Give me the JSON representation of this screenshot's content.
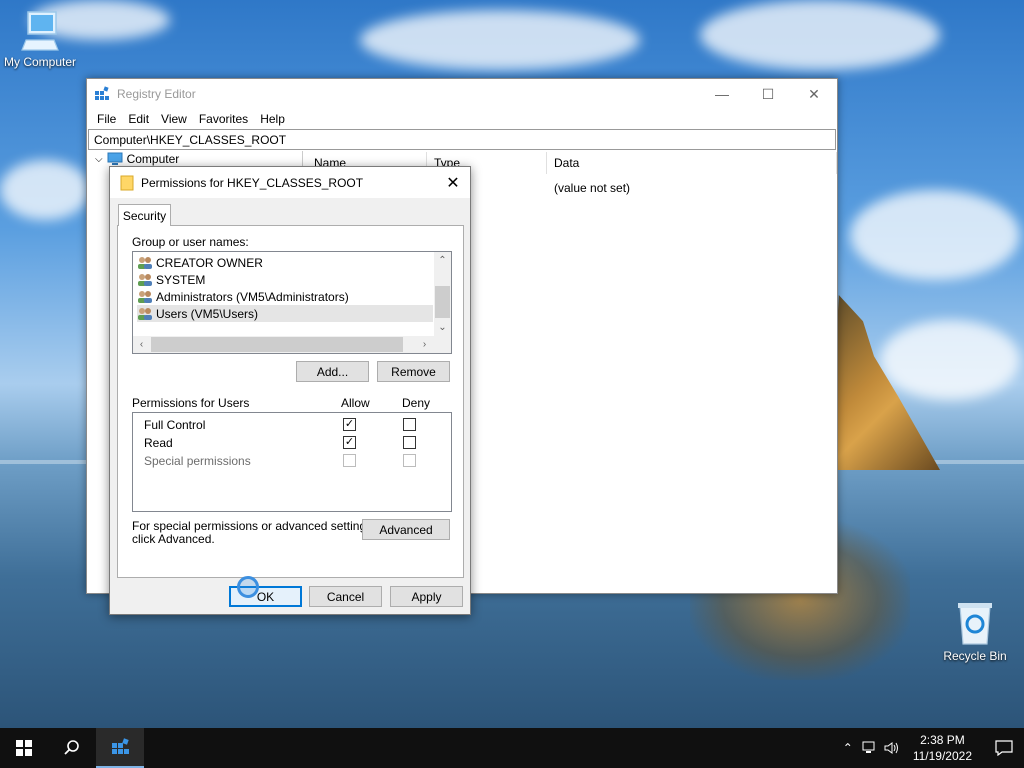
{
  "desktop": {
    "icons": [
      {
        "label": "My Computer"
      },
      {
        "label": "Recycle Bin"
      }
    ]
  },
  "regedit": {
    "title": "Registry Editor",
    "menu": [
      "File",
      "Edit",
      "View",
      "Favorites",
      "Help"
    ],
    "address": "Computer\\HKEY_CLASSES_ROOT",
    "tree_root": "Computer",
    "columns": {
      "name": "Name",
      "type": "Type",
      "data": "Data"
    },
    "row": {
      "data": "(value not set)"
    }
  },
  "dialog": {
    "title": "Permissions for HKEY_CLASSES_ROOT",
    "tab": "Security",
    "group_label": "Group or user names:",
    "users": [
      {
        "name": "CREATOR OWNER"
      },
      {
        "name": "SYSTEM"
      },
      {
        "name": "Administrators (VM5\\Administrators)"
      },
      {
        "name": "Users (VM5\\Users)"
      }
    ],
    "add_label": "Add...",
    "remove_label": "Remove",
    "perm_label": "Permissions for Users",
    "allow_label": "Allow",
    "deny_label": "Deny",
    "permissions": [
      {
        "name": "Full Control",
        "allow": true,
        "deny": false,
        "enabled": true
      },
      {
        "name": "Read",
        "allow": true,
        "deny": false,
        "enabled": true
      },
      {
        "name": "Special permissions",
        "allow": false,
        "deny": false,
        "enabled": false
      }
    ],
    "special_note_1": "For special permissions or advanced settings,",
    "special_note_2": "click Advanced.",
    "advanced_label": "Advanced",
    "ok_label": "OK",
    "cancel_label": "Cancel",
    "apply_label": "Apply"
  },
  "taskbar": {
    "time": "2:38 PM",
    "date": "11/19/2022"
  },
  "colors": {
    "accent": "#0078d7",
    "taskbar": "#101010"
  }
}
